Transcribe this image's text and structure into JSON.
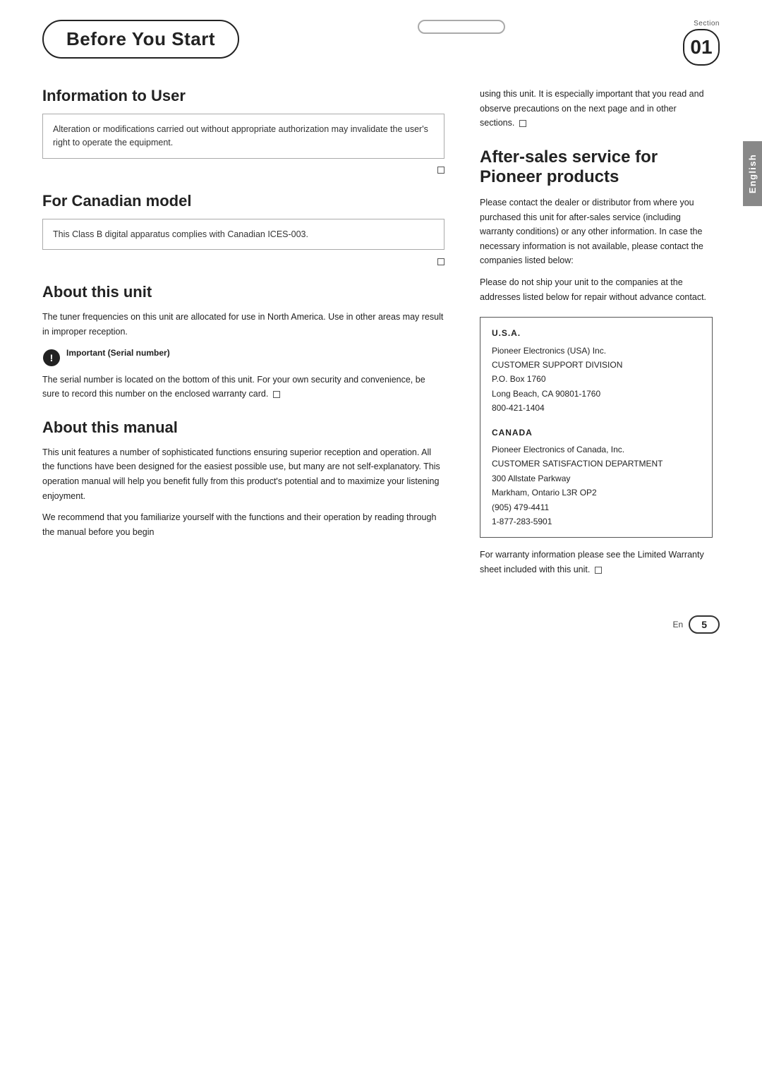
{
  "header": {
    "before_you_start": "Before You Start",
    "section_label": "Section",
    "section_number": "01"
  },
  "sidebar": {
    "language_label": "English"
  },
  "left_column": {
    "info_to_user": {
      "heading": "Information to User",
      "box_text": "Alteration or modifications carried out without appropriate authorization may invalidate the user's right to operate the equipment."
    },
    "for_canadian_model": {
      "heading": "For Canadian model",
      "box_text": "This Class B digital apparatus complies with Canadian ICES-003."
    },
    "about_this_unit": {
      "heading": "About this unit",
      "body": "The tuner frequencies on this unit are allocated for use in North America. Use in other areas may result in improper reception.",
      "important_label": "Important (Serial number)",
      "important_body": "The serial number is located on the bottom of this unit. For your own security and convenience, be sure to record this number on the enclosed warranty card."
    },
    "about_this_manual": {
      "heading": "About this manual",
      "body1": "This unit features a number of sophisticated functions ensuring superior reception and operation. All the functions have been designed for the easiest possible use, but many are not self-explanatory. This operation manual will help you benefit fully from this product's potential and to maximize your listening enjoyment.",
      "body2": "We recommend that you familiarize yourself with the functions and their operation by reading through the manual before you begin"
    }
  },
  "right_column": {
    "continued_text": "using this unit. It is especially important that you read and observe precautions on the next page and in other sections.",
    "after_sales": {
      "heading": "After-sales service for Pioneer products",
      "body1": "Please contact the dealer or distributor from where you purchased this unit for after-sales service (including warranty conditions) or any other information. In case the necessary information is not available, please contact the companies listed below:",
      "body2": "Please do not ship your unit to the companies at the addresses listed below for repair without advance contact.",
      "usa": {
        "heading": "U.S.A.",
        "line1": "Pioneer Electronics (USA) Inc.",
        "line2": "CUSTOMER SUPPORT DIVISION",
        "line3": "P.O. Box 1760",
        "line4": "Long Beach, CA 90801-1760",
        "line5": "800-421-1404"
      },
      "canada": {
        "heading": "CANADA",
        "line1": "Pioneer Electronics of Canada, Inc.",
        "line2": "CUSTOMER SATISFACTION DEPARTMENT",
        "line3": "300 Allstate Parkway",
        "line4": "Markham, Ontario L3R OP2",
        "line5": "(905) 479-4411",
        "line6": "1-877-283-5901"
      }
    },
    "warranty_note": "For warranty information please see the Limited Warranty sheet included with this unit."
  },
  "footer": {
    "en_label": "En",
    "page_number": "5"
  }
}
